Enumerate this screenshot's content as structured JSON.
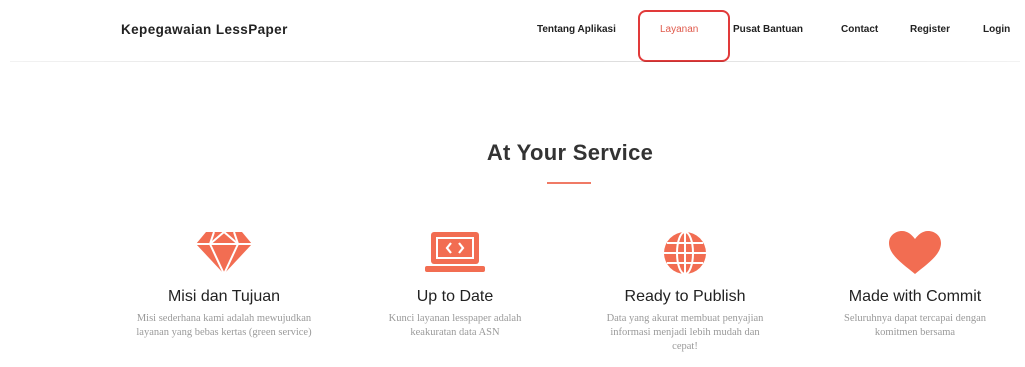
{
  "navbar": {
    "brand": "Kepegawaian LessPaper",
    "links": [
      {
        "label": "Tentang Aplikasi",
        "active": false
      },
      {
        "label": "Layanan",
        "active": true
      },
      {
        "label": "Pusat Bantuan",
        "active": false
      },
      {
        "label": "Contact",
        "active": false
      },
      {
        "label": "Register",
        "active": false
      },
      {
        "label": "Login",
        "active": false
      }
    ]
  },
  "services": {
    "title": "At Your Service",
    "accent_color": "#f26d52",
    "features": [
      {
        "icon": "diamond-icon",
        "title": "Misi dan Tujuan",
        "description": "Misi sederhana kami adalah mewujudkan layanan yang bebas kertas (green service)"
      },
      {
        "icon": "laptop-code-icon",
        "title": "Up to Date",
        "description": "Kunci layanan lesspaper adalah keakuratan data ASN"
      },
      {
        "icon": "globe-icon",
        "title": "Ready to Publish",
        "description": "Data yang akurat membuat penyajian informasi menjadi lebih mudah dan cepat!"
      },
      {
        "icon": "heart-icon",
        "title": "Made with Commit",
        "description": "Seluruhnya dapat tercapai dengan komitmen bersama"
      }
    ]
  }
}
